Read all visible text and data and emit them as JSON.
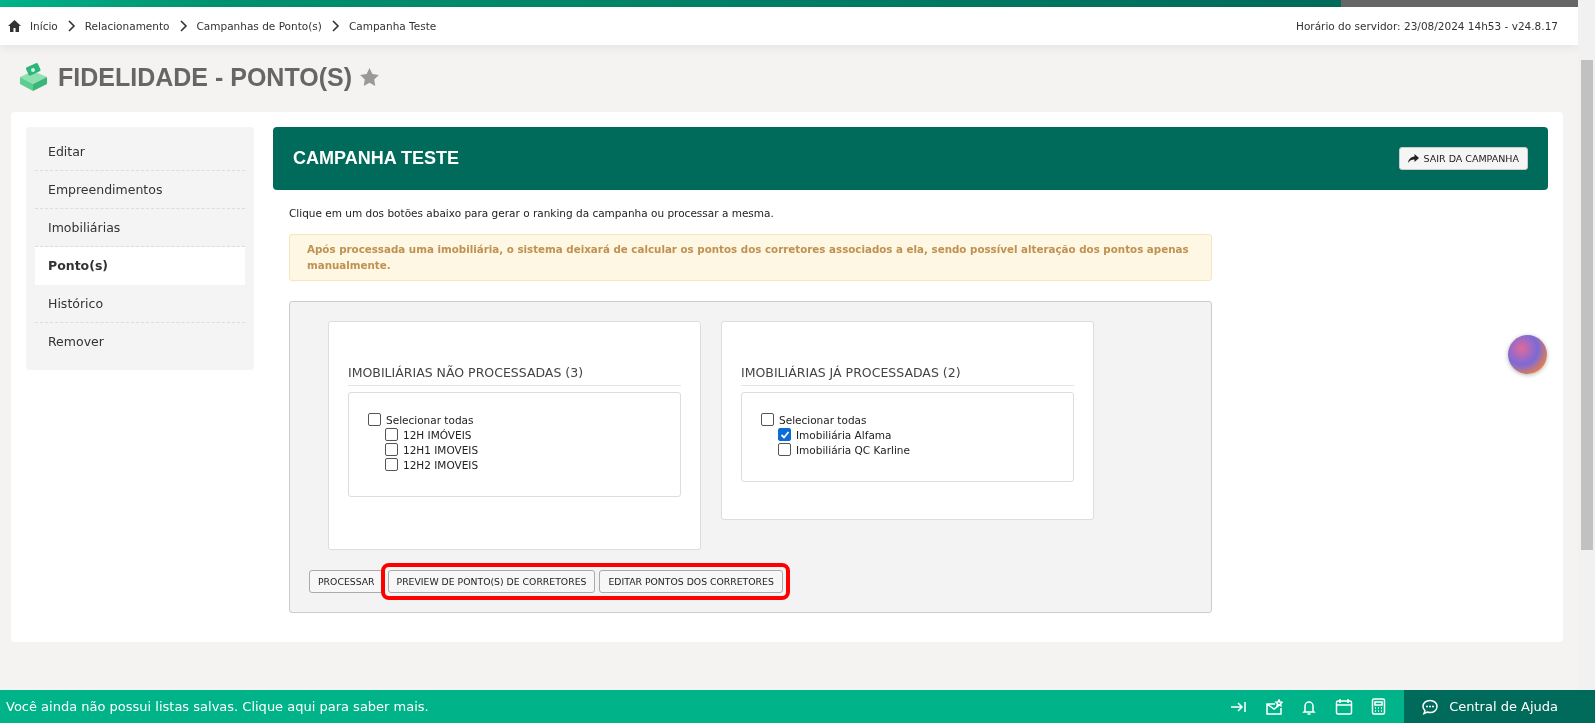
{
  "breadcrumb": {
    "items": [
      {
        "label": "Início"
      },
      {
        "label": "Relacionamento"
      },
      {
        "label": "Campanhas de Ponto(s)"
      },
      {
        "label": "Campanha Teste"
      }
    ],
    "server_info": "Horário do servidor: 23/08/2024 14h53 - v24.8.17"
  },
  "page_title": "FIDELIDADE - PONTO(S)",
  "sidebar": {
    "items": [
      {
        "label": "Editar",
        "selected": false
      },
      {
        "label": "Empreendimentos",
        "selected": false
      },
      {
        "label": "Imobiliárias",
        "selected": false
      },
      {
        "label": "Ponto(s)",
        "selected": true
      },
      {
        "label": "Histórico",
        "selected": false
      },
      {
        "label": "Remover",
        "selected": false
      }
    ]
  },
  "campaign": {
    "title": "CAMPANHA TESTE",
    "exit_button": "SAIR DA CAMPANHA"
  },
  "intro": "Clique em um dos botões abaixo para gerar o ranking da campanha ou processar a mesma.",
  "warning": "Após processada uma imobiliária, o sistema deixará de calcular os pontos dos corretores associados a ela, sendo possível alteração dos pontos apenas manualmente.",
  "panels": [
    {
      "title": "IMOBILIÁRIAS NÃO PROCESSADAS (3)",
      "select_all": {
        "label": "Selecionar todas",
        "checked": false
      },
      "items": [
        {
          "label": "12H IMÓVEIS",
          "checked": false
        },
        {
          "label": "12H1 IMOVEIS",
          "checked": false
        },
        {
          "label": "12H2 IMOVEIS",
          "checked": false
        }
      ]
    },
    {
      "title": "IMOBILIÁRIAS JÁ PROCESSADAS (2)",
      "select_all": {
        "label": "Selecionar todas",
        "checked": false
      },
      "items": [
        {
          "label": "Imobiliária Alfama",
          "checked": true
        },
        {
          "label": "Imobiliária QC Karline",
          "checked": false
        }
      ]
    }
  ],
  "buttons": [
    {
      "label": "PROCESSAR",
      "highlighted": false
    },
    {
      "label": "PREVIEW DE PONTO(S) DE CORRETORES",
      "highlighted": true
    },
    {
      "label": "EDITAR PONTOS DOS CORRETORES",
      "highlighted": true
    }
  ],
  "footer": {
    "message": "Você ainda não possui listas salvas. Clique aqui para saber mais.",
    "help_label": "Central de Ajuda"
  }
}
